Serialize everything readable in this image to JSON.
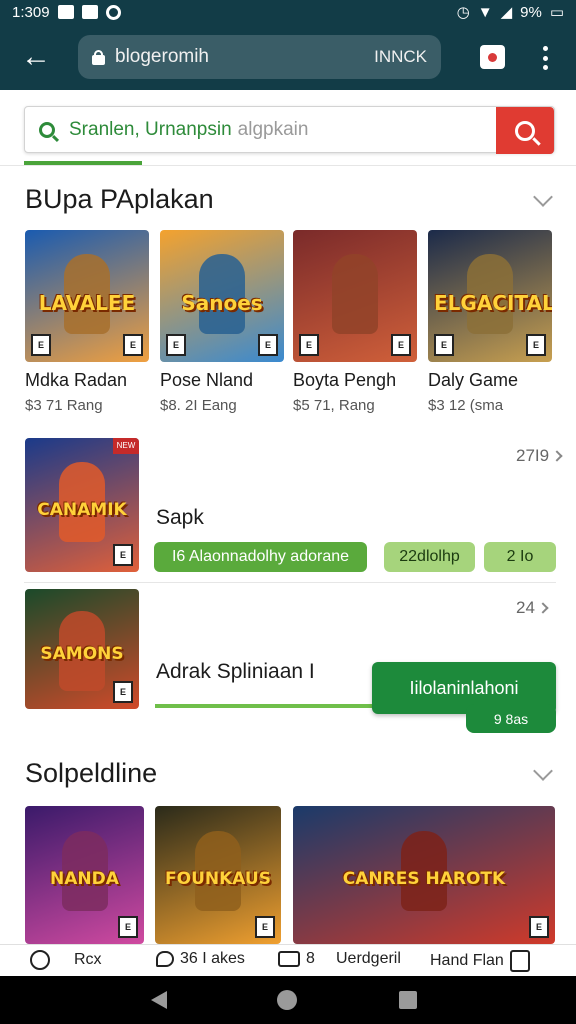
{
  "status_bar": {
    "time": "1:309",
    "battery_text": "9%"
  },
  "browser": {
    "url": "blogeromih",
    "url_right": "INNCK",
    "back_label": "←"
  },
  "search": {
    "typed": "Sranlen, Urnanpsin",
    "placeholder": "algpkain"
  },
  "section1": {
    "title": "BUpa PAplakan",
    "games": [
      {
        "name": "Mdka Radan",
        "sub": "$3 71 Rang",
        "art": "LAVALEE",
        "colors": [
          "#1a5bb0",
          "#f0a040"
        ]
      },
      {
        "name": "Pose Nland",
        "sub": "$8. 2I Eang",
        "art": "Sanoes",
        "colors": [
          "#f4a22e",
          "#3a8ad0"
        ]
      },
      {
        "name": "Boyta Pengh",
        "sub": "$5 71, Rang",
        "art": "",
        "colors": [
          "#7a2a2a",
          "#d0603a"
        ]
      },
      {
        "name": "Daly Game",
        "sub": "$3 12 (sma",
        "art": "ELGACITAL",
        "colors": [
          "#1b2a4a",
          "#c8a050"
        ]
      }
    ]
  },
  "list_rows": [
    {
      "title": "Sapk",
      "meta": "27I9",
      "art": "CANAMIK",
      "pills": [
        "I6 Alaonnadolhy adorane",
        "22dlolhp",
        "2 Io"
      ]
    },
    {
      "title": "Adrak Spliniaan I",
      "meta": "24",
      "art": "SAMONS",
      "install_label": "Iilolaninlahoni",
      "size_label": "9 8as"
    }
  ],
  "section2": {
    "title": "Solpeldline",
    "games": [
      {
        "art": "NANDA",
        "colors": [
          "#3a1a6a",
          "#d04aa0"
        ]
      },
      {
        "art": "FOUNKAUS",
        "colors": [
          "#2a2a1a",
          "#f0a030"
        ]
      },
      {
        "art": "CANRES HAROTK",
        "colors": [
          "#1a3a6a",
          "#d03a2a"
        ]
      }
    ]
  },
  "bottom_nav": [
    {
      "label": "Rcx",
      "icon": "gamepad-icon"
    },
    {
      "label": "36 I akes",
      "icon": "chat-icon"
    },
    {
      "label": "8",
      "icon": "tv-icon"
    },
    {
      "label": "Uerdgeril",
      "icon": ""
    },
    {
      "label": "Hand Flan",
      "icon": "pages-icon"
    }
  ]
}
